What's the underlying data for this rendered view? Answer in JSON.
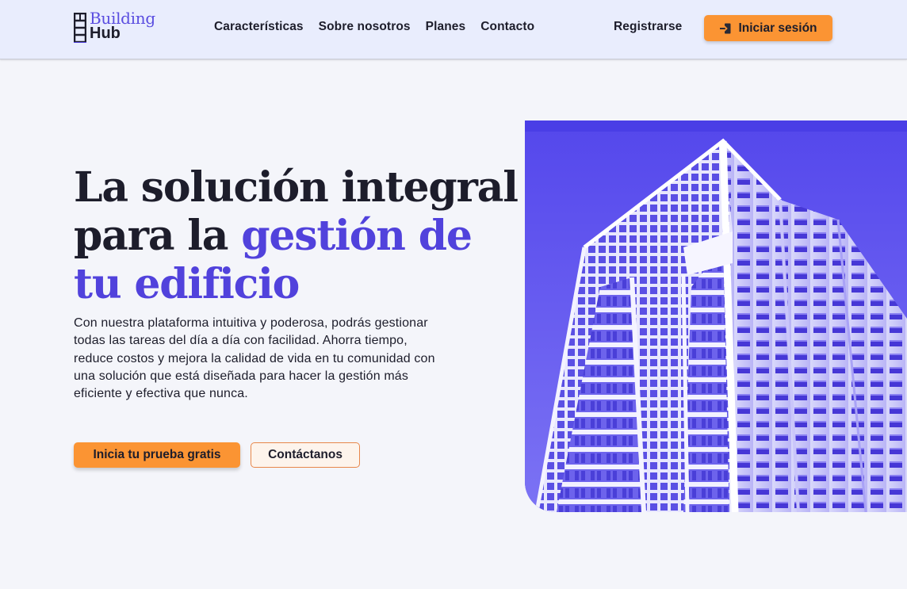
{
  "brand": {
    "line1": "Building",
    "line2": "Hub",
    "primary_color": "#5142dc",
    "accent_color": "#fb9433"
  },
  "nav": {
    "links": [
      "Características",
      "Sobre nosotros",
      "Planes",
      "Contacto"
    ],
    "register_label": "Registrarse",
    "login_label": "Iniciar sesión",
    "login_icon": "login-arrow-icon"
  },
  "hero": {
    "title_part1": "La solución integral para la ",
    "title_accent": "gestión de tu edificio",
    "description": "Con nuestra plataforma intuitiva y poderosa, podrás gestionar todas las tareas del día a día con facilidad. Ahorra tiempo, reduce costos y mejora la calidad de vida en tu comunidad con una solución que está diseñada para hacer la gestión más eficiente y efectiva que nunca.",
    "cta_primary": "Inicia tu prueba gratis",
    "cta_secondary": "Contáctanos",
    "image": "tall-residential-building-photo"
  }
}
